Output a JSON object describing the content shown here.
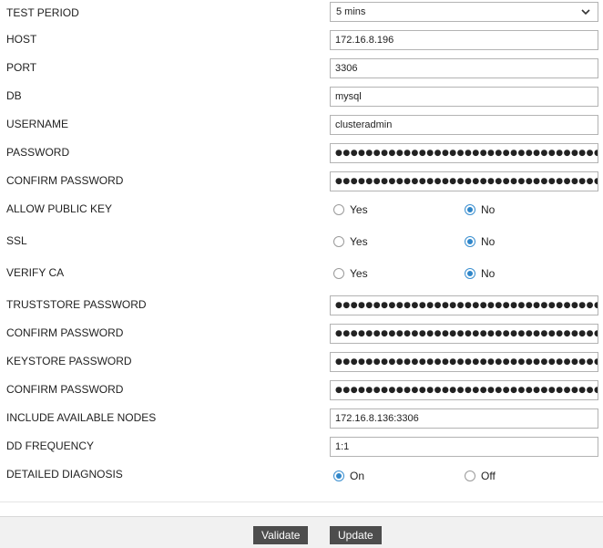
{
  "form": {
    "test_period": {
      "label": "TEST PERIOD",
      "value": "5 mins"
    },
    "host": {
      "label": "HOST",
      "value": "172.16.8.196"
    },
    "port": {
      "label": "PORT",
      "value": "3306"
    },
    "db": {
      "label": "DB",
      "value": "mysql"
    },
    "username": {
      "label": "USERNAME",
      "value": "clusteradmin"
    },
    "password": {
      "label": "PASSWORD",
      "value": "●●●●●●●●●●●●●●●●●●●●●●●●●●●●●●●●●●●●●●●●●●●●●●●●"
    },
    "confirm_password": {
      "label": "CONFIRM PASSWORD",
      "value": "●●●●●●●●●●●●●●●●●●●●●●●●●●●●●●●●●●●●●●●●●●●●●●●●"
    },
    "allow_public_key": {
      "label": "ALLOW PUBLIC KEY",
      "options": [
        "Yes",
        "No"
      ],
      "selected": "No"
    },
    "ssl": {
      "label": "SSL",
      "options": [
        "Yes",
        "No"
      ],
      "selected": "No"
    },
    "verify_ca": {
      "label": "VERIFY CA",
      "options": [
        "Yes",
        "No"
      ],
      "selected": "No"
    },
    "truststore_password": {
      "label": "TRUSTSTORE PASSWORD",
      "value": "●●●●●●●●●●●●●●●●●●●●●●●●●●●●●●●●●●●●"
    },
    "truststore_confirm": {
      "label": "CONFIRM PASSWORD",
      "value": "●●●●●●●●●●●●●●●●●●●●●●●●●●●●●●●●●●●●"
    },
    "keystore_password": {
      "label": "KEYSTORE PASSWORD",
      "value": "●●●●●●●●●●●●●●●●●●●●●●●●●●●●●●●●●●●●"
    },
    "keystore_confirm": {
      "label": "CONFIRM PASSWORD",
      "value": "●●●●●●●●●●●●●●●●●●●●●●●●●●●●●●●●●●●●"
    },
    "include_available_nodes": {
      "label": "INCLUDE AVAILABLE NODES",
      "value": "172.16.8.136:3306"
    },
    "dd_frequency": {
      "label": "DD FREQUENCY",
      "value": "1:1"
    },
    "detailed_diagnosis": {
      "label": "DETAILED DIAGNOSIS",
      "options": [
        "On",
        "Off"
      ],
      "selected": "On"
    }
  },
  "footer": {
    "validate_label": "Validate",
    "update_label": "Update"
  },
  "colors": {
    "accent": "#2f86c9",
    "button_bg": "#4d4d4d",
    "footer_bg": "#f1f1f1"
  }
}
